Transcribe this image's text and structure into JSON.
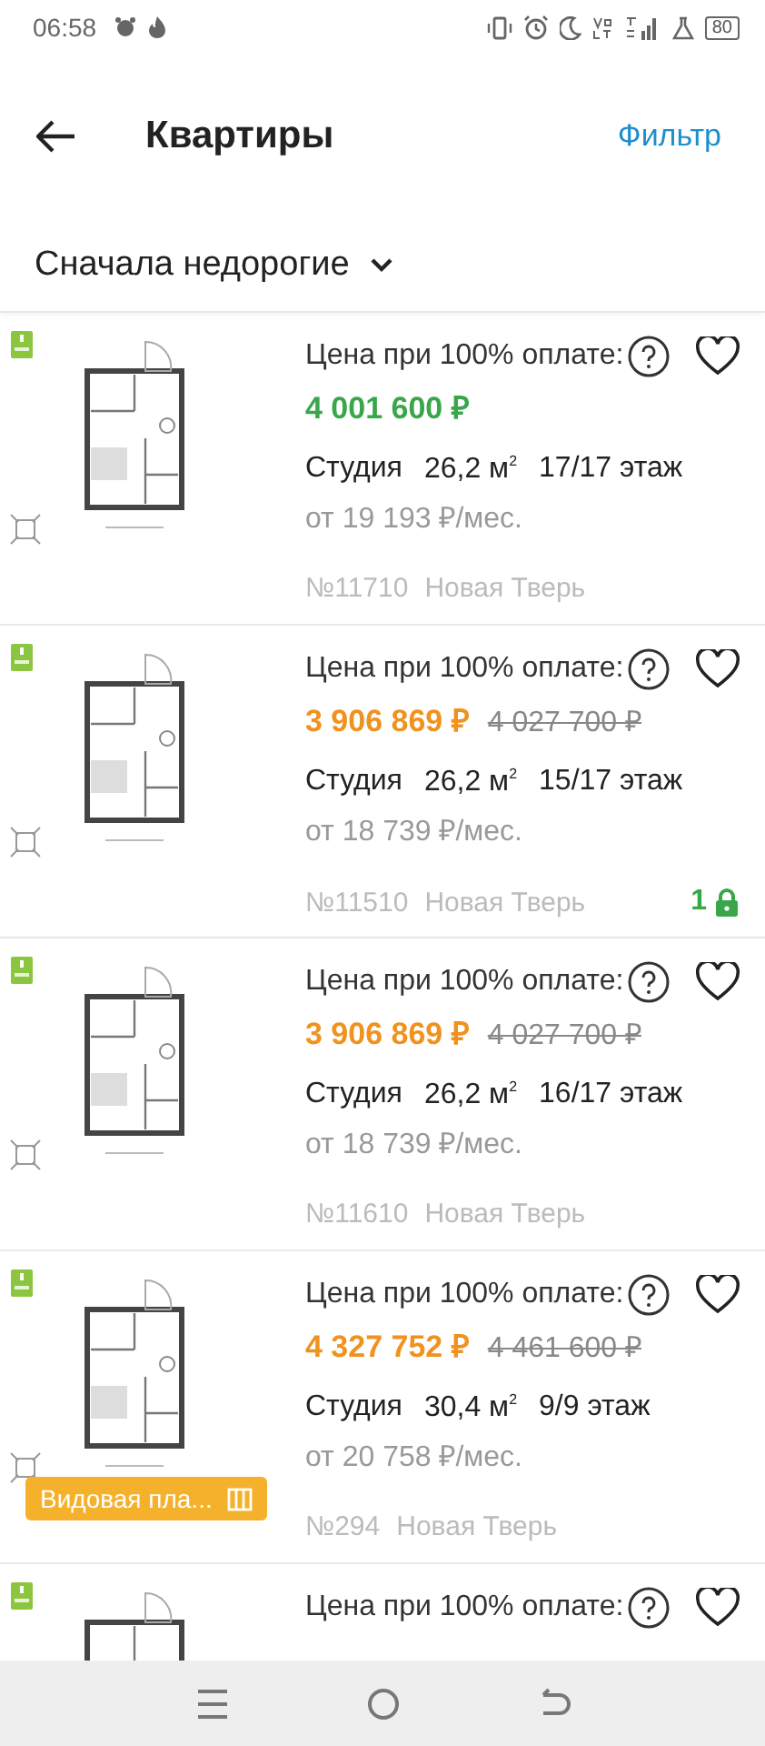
{
  "status_bar": {
    "time": "06:58",
    "battery": "80"
  },
  "app_bar": {
    "title": "Квартиры",
    "action": "Фильтр"
  },
  "sort": {
    "label": "Сначала недорогие"
  },
  "listings": [
    {
      "price_label": "Цена при 100% оплате:",
      "price": "4 001 600 ₽",
      "discounted": false,
      "type": "Студия",
      "area": "26,2 м",
      "area_unit_sup": "2",
      "floor": "17/17 этаж",
      "monthly": "от 19 193 ₽/мес.",
      "number": "№11710",
      "project": "Новая Тверь",
      "favorite": false
    },
    {
      "price_label": "Цена при 100% оплате:",
      "price": "3 906 869 ₽",
      "discounted": true,
      "old_price": "4 027 700 ₽",
      "type": "Студия",
      "area": "26,2 м",
      "area_unit_sup": "2",
      "floor": "15/17 этаж",
      "monthly": "от 18 739 ₽/мес.",
      "number": "№11510",
      "project": "Новая Тверь",
      "lock_count": "1",
      "favorite": false
    },
    {
      "price_label": "Цена при 100% оплате:",
      "price": "3 906 869 ₽",
      "discounted": true,
      "old_price": "4 027 700 ₽",
      "type": "Студия",
      "area": "26,2 м",
      "area_unit_sup": "2",
      "floor": "16/17 этаж",
      "monthly": "от 18 739 ₽/мес.",
      "number": "№11610",
      "project": "Новая Тверь",
      "favorite": false
    },
    {
      "price_label": "Цена при 100% оплате:",
      "price": "4 327 752 ₽",
      "discounted": true,
      "old_price": "4 461 600 ₽",
      "type": "Студия",
      "area": "30,4 м",
      "area_unit_sup": "2",
      "floor": "9/9 этаж",
      "monthly": "от 20 758 ₽/мес.",
      "number": "№294",
      "project": "Новая Тверь",
      "view_label": "Видовая пла...",
      "favorite": false
    },
    {
      "price_label": "Цена при 100% оплате:",
      "favorite": false
    }
  ]
}
